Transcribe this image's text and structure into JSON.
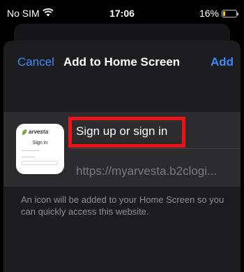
{
  "status_bar": {
    "carrier": "No SIM",
    "time": "17:06",
    "battery": "16%",
    "battery_level": 0.16
  },
  "nav": {
    "cancel_label": "Cancel",
    "title": "Add to Home Screen",
    "add_label": "Add"
  },
  "app_icon": {
    "logo_text": "arvesta",
    "heading": "Sign in"
  },
  "name_field": {
    "value": "Sign up or sign in"
  },
  "url": {
    "value": "https://myarvesta.b2clogi..."
  },
  "footer": {
    "note": "An icon will be added to your Home Screen so you can quickly access this website."
  },
  "colors": {
    "accent": "#3a8bff",
    "highlight": "#e8141a",
    "battery": "#f4c20d"
  }
}
